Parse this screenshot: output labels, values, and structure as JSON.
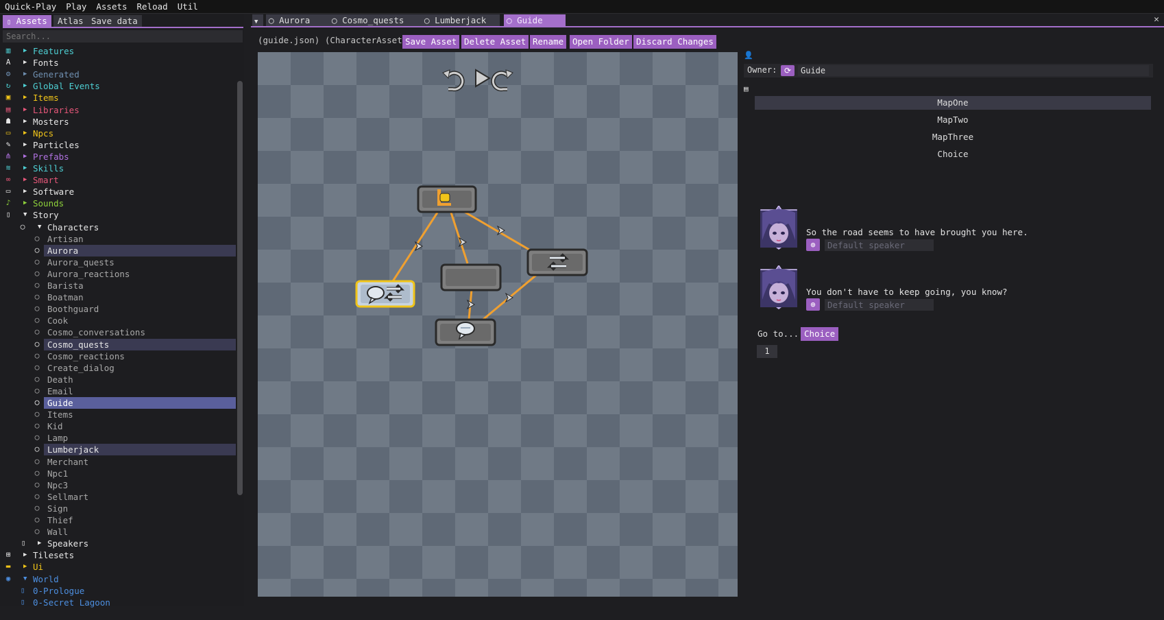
{
  "menu": [
    "Quick-Play",
    "Play",
    "Assets",
    "Reload",
    "Util"
  ],
  "left": {
    "tabs": [
      "Assets",
      "Atlas",
      "Save data"
    ],
    "search_placeholder": "Search...",
    "tree": [
      {
        "label": "Features",
        "color": "#4ed0d4",
        "icon": "features-icon",
        "icolor": "#4ed0d4",
        "depth": 0,
        "arrow": "▶"
      },
      {
        "label": "Fonts",
        "color": "#e6e6e6",
        "icon": "font-icon",
        "icolor": "#e6e6e6",
        "depth": 0,
        "arrow": "▶"
      },
      {
        "label": "Generated",
        "color": "#6f8fb0",
        "icon": "gears-icon",
        "icolor": "#6f8fb0",
        "depth": 0,
        "arrow": "▶"
      },
      {
        "label": "Global Events",
        "color": "#4ed0d4",
        "icon": "sync-icon",
        "icolor": "#4ed0d4",
        "depth": 0,
        "arrow": "▶"
      },
      {
        "label": "Items",
        "color": "#f0c419",
        "icon": "lock-icon",
        "icolor": "#f0c419",
        "depth": 0,
        "arrow": "▶"
      },
      {
        "label": "Libraries",
        "color": "#e8577a",
        "icon": "library-icon",
        "icolor": "#e8577a",
        "depth": 0,
        "arrow": "▶"
      },
      {
        "label": "Mosters",
        "color": "#e6e6e6",
        "icon": "ghost-icon",
        "icolor": "#e6e6e6",
        "depth": 0,
        "arrow": "▶"
      },
      {
        "label": "Npcs",
        "color": "#f0c419",
        "icon": "id-card-icon",
        "icolor": "#f0c419",
        "depth": 0,
        "arrow": "▶"
      },
      {
        "label": "Particles",
        "color": "#e6e6e6",
        "icon": "magic-wand-icon",
        "icolor": "#e6e6e6",
        "depth": 0,
        "arrow": "▶"
      },
      {
        "label": "Prefabs",
        "color": "#b072e0",
        "icon": "hierarchy-icon",
        "icolor": "#b072e0",
        "depth": 0,
        "arrow": "▶"
      },
      {
        "label": "Skills",
        "color": "#4ed0d4",
        "icon": "skills-icon",
        "icolor": "#4ed0d4",
        "depth": 0,
        "arrow": "▶"
      },
      {
        "label": "Smart",
        "color": "#e8577a",
        "icon": "glasses-icon",
        "icolor": "#e8577a",
        "depth": 0,
        "arrow": "▶"
      },
      {
        "label": "Software",
        "color": "#e6e6e6",
        "icon": "computer-icon",
        "icolor": "#e6e6e6",
        "depth": 0,
        "arrow": "▶"
      },
      {
        "label": "Sounds",
        "color": "#8ed13b",
        "icon": "guitar-icon",
        "icolor": "#8ed13b",
        "depth": 0,
        "arrow": "▶"
      },
      {
        "label": "Story",
        "color": "#e6e6e6",
        "icon": "book-icon",
        "icolor": "#e6e6e6",
        "depth": 0,
        "arrow": "▼"
      },
      {
        "label": "Characters",
        "color": "#e6e6e6",
        "icon": "speech-bubble-icon",
        "icolor": "#dcdcdc",
        "depth": 1,
        "arrow": "▼"
      },
      {
        "label": "Artisan",
        "color": "#a9a9a9",
        "icon": "speech-bubble-icon",
        "icolor": "#a9a9a9",
        "depth": 2,
        "arrow": ""
      },
      {
        "label": "Aurora",
        "color": "#e6e6e6",
        "icon": "speech-bubble-icon",
        "icolor": "#e6e6e6",
        "depth": 2,
        "arrow": "",
        "sel": "sel"
      },
      {
        "label": "Aurora_quests",
        "color": "#a9a9a9",
        "icon": "speech-bubble-icon",
        "icolor": "#a9a9a9",
        "depth": 2,
        "arrow": ""
      },
      {
        "label": "Aurora_reactions",
        "color": "#a9a9a9",
        "icon": "speech-bubble-icon",
        "icolor": "#a9a9a9",
        "depth": 2,
        "arrow": ""
      },
      {
        "label": "Barista",
        "color": "#a9a9a9",
        "icon": "speech-bubble-icon",
        "icolor": "#a9a9a9",
        "depth": 2,
        "arrow": ""
      },
      {
        "label": "Boatman",
        "color": "#a9a9a9",
        "icon": "speech-bubble-icon",
        "icolor": "#a9a9a9",
        "depth": 2,
        "arrow": ""
      },
      {
        "label": "Boothguard",
        "color": "#a9a9a9",
        "icon": "speech-bubble-icon",
        "icolor": "#a9a9a9",
        "depth": 2,
        "arrow": ""
      },
      {
        "label": "Cook",
        "color": "#a9a9a9",
        "icon": "speech-bubble-icon",
        "icolor": "#a9a9a9",
        "depth": 2,
        "arrow": ""
      },
      {
        "label": "Cosmo_conversations",
        "color": "#a9a9a9",
        "icon": "speech-bubble-icon",
        "icolor": "#a9a9a9",
        "depth": 2,
        "arrow": ""
      },
      {
        "label": "Cosmo_quests",
        "color": "#e6e6e6",
        "icon": "speech-bubble-icon",
        "icolor": "#e6e6e6",
        "depth": 2,
        "arrow": "",
        "sel": "sel"
      },
      {
        "label": "Cosmo_reactions",
        "color": "#a9a9a9",
        "icon": "speech-bubble-icon",
        "icolor": "#a9a9a9",
        "depth": 2,
        "arrow": ""
      },
      {
        "label": "Create_dialog",
        "color": "#a9a9a9",
        "icon": "speech-bubble-icon",
        "icolor": "#a9a9a9",
        "depth": 2,
        "arrow": ""
      },
      {
        "label": "Death",
        "color": "#a9a9a9",
        "icon": "speech-bubble-icon",
        "icolor": "#a9a9a9",
        "depth": 2,
        "arrow": ""
      },
      {
        "label": "Email",
        "color": "#a9a9a9",
        "icon": "speech-bubble-icon",
        "icolor": "#a9a9a9",
        "depth": 2,
        "arrow": ""
      },
      {
        "label": "Guide",
        "color": "#ffffff",
        "icon": "speech-bubble-icon",
        "icolor": "#ffffff",
        "depth": 2,
        "arrow": "",
        "sel": "sel2"
      },
      {
        "label": "Items",
        "color": "#a9a9a9",
        "icon": "speech-bubble-icon",
        "icolor": "#a9a9a9",
        "depth": 2,
        "arrow": ""
      },
      {
        "label": "Kid",
        "color": "#a9a9a9",
        "icon": "speech-bubble-icon",
        "icolor": "#a9a9a9",
        "depth": 2,
        "arrow": ""
      },
      {
        "label": "Lamp",
        "color": "#a9a9a9",
        "icon": "speech-bubble-icon",
        "icolor": "#a9a9a9",
        "depth": 2,
        "arrow": ""
      },
      {
        "label": "Lumberjack",
        "color": "#e6e6e6",
        "icon": "speech-bubble-icon",
        "icolor": "#e6e6e6",
        "depth": 2,
        "arrow": "",
        "sel": "sel"
      },
      {
        "label": "Merchant",
        "color": "#a9a9a9",
        "icon": "speech-bubble-icon",
        "icolor": "#a9a9a9",
        "depth": 2,
        "arrow": ""
      },
      {
        "label": "Npc1",
        "color": "#a9a9a9",
        "icon": "speech-bubble-icon",
        "icolor": "#a9a9a9",
        "depth": 2,
        "arrow": ""
      },
      {
        "label": "Npc3",
        "color": "#a9a9a9",
        "icon": "speech-bubble-icon",
        "icolor": "#a9a9a9",
        "depth": 2,
        "arrow": ""
      },
      {
        "label": "Sellmart",
        "color": "#a9a9a9",
        "icon": "speech-bubble-icon",
        "icolor": "#a9a9a9",
        "depth": 2,
        "arrow": ""
      },
      {
        "label": "Sign",
        "color": "#a9a9a9",
        "icon": "speech-bubble-icon",
        "icolor": "#a9a9a9",
        "depth": 2,
        "arrow": ""
      },
      {
        "label": "Thief",
        "color": "#a9a9a9",
        "icon": "speech-bubble-icon",
        "icolor": "#a9a9a9",
        "depth": 2,
        "arrow": ""
      },
      {
        "label": "Wall",
        "color": "#a9a9a9",
        "icon": "speech-bubble-icon",
        "icolor": "#a9a9a9",
        "depth": 2,
        "arrow": ""
      },
      {
        "label": "Speakers",
        "color": "#e6e6e6",
        "icon": "portrait-icon",
        "icolor": "#dcdcdc",
        "depth": 1,
        "arrow": "▶"
      },
      {
        "label": "Tilesets",
        "color": "#e6e6e6",
        "icon": "grid-icon",
        "icolor": "#e6e6e6",
        "depth": 0,
        "arrow": "▶"
      },
      {
        "label": "Ui",
        "color": "#f0c419",
        "icon": "ui-icon",
        "icolor": "#f0c419",
        "depth": 0,
        "arrow": "▶"
      },
      {
        "label": "World",
        "color": "#4d8fe0",
        "icon": "globe-icon",
        "icolor": "#4d8fe0",
        "depth": 0,
        "arrow": "▼"
      },
      {
        "label": "0-Prologue",
        "color": "#4d8fe0",
        "icon": "map-icon",
        "icolor": "#4d8fe0",
        "depth": 1,
        "arrow": ""
      },
      {
        "label": "0-Secret Lagoon",
        "color": "#4d8fe0",
        "icon": "map-icon",
        "icolor": "#4d8fe0",
        "depth": 1,
        "arrow": ""
      }
    ]
  },
  "main": {
    "tabs": [
      "Aurora",
      "Cosmo_quests",
      "Lumberjack",
      "Guide"
    ],
    "active_tab": "Guide",
    "file_label": "(guide.json) (CharacterAsset)",
    "toolbar": [
      "Save Asset",
      "Delete Asset",
      "Rename",
      "Open Folder",
      "Discard Changes"
    ],
    "close": "✕"
  },
  "right": {
    "owner_label": "Owner:",
    "owner_value": "Guide",
    "situations": [
      "MapOne",
      "MapTwo",
      "MapThree",
      "Choice"
    ],
    "selected_situation": "MapOne",
    "dialog": [
      {
        "text": "So the road seems to have brought you here.",
        "speaker_placeholder": "Default speaker"
      },
      {
        "text": "You don't have to keep going, you know?",
        "speaker_placeholder": "Default speaker"
      }
    ],
    "goto_label": "Go to...",
    "goto_value": "Choice",
    "number_value": "1"
  },
  "colors": {
    "accent": "#a46fcb",
    "button": "#9b5fc0",
    "graph_line": "#f0a030",
    "node": "#8e8e8e"
  }
}
